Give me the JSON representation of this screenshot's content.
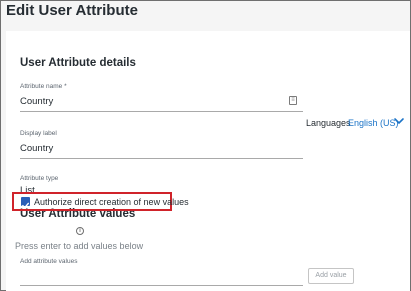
{
  "page_title": "Edit User Attribute",
  "details": {
    "section_title": "User Attribute details",
    "attribute_name": {
      "label": "Attribute name *",
      "value": "Country"
    },
    "display_label": {
      "label": "Display label",
      "value": "Country"
    },
    "languages": {
      "label": "Languages",
      "value": "English (US)"
    },
    "attribute_type": {
      "label": "Attribute type",
      "value": "List"
    }
  },
  "values": {
    "section_title": "User Attribute values",
    "authorize_checkbox": {
      "label": "Authorize direct creation of new values",
      "checked": true
    },
    "add_values": {
      "label": "Add attribute values",
      "placeholder": "Press enter to add values below",
      "button_label": "Add value"
    }
  },
  "colors": {
    "accent": "#1a73c7",
    "checkbox": "#2a5fb8",
    "highlight": "#d0232a"
  }
}
